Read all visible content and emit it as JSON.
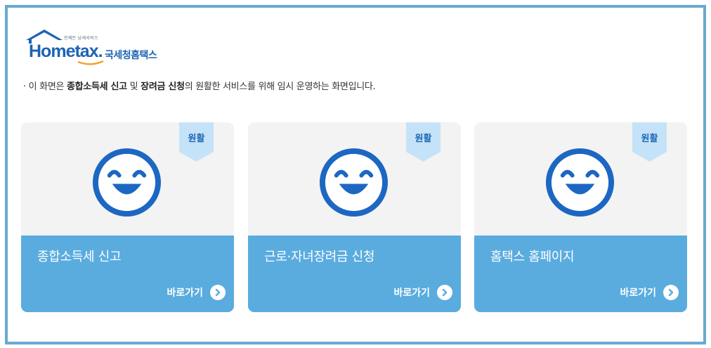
{
  "logo": {
    "tagline": "언제든 납세서비스",
    "word_hom": "Hom",
    "word_e": "e",
    "word_tax": "tax.",
    "korean_name": "국세청홈택스"
  },
  "notice": {
    "prefix": "· 이 화면은 ",
    "bold1": "종합소득세 신고",
    "middle": " 및 ",
    "bold2": "장려금 신청",
    "suffix": "의 원활한 서비스를 위해 임시 운영하는 화면입니다."
  },
  "colors": {
    "frame_border": "#6aaad0",
    "card_bottom": "#5aacdf",
    "card_top": "#f3f3f3",
    "ribbon": "#c5e3f8",
    "face": "#1c67c2",
    "logo_blue": "#1d63b3"
  },
  "cards": [
    {
      "status": "원활",
      "icon": "smiley-face-icon",
      "title": "종합소득세 신고",
      "link_label": "바로가기",
      "link_icon": "chevron-right-circle-icon"
    },
    {
      "status": "원활",
      "icon": "smiley-face-icon",
      "title": "근로·자녀장려금 신청",
      "link_label": "바로가기",
      "link_icon": "chevron-right-circle-icon"
    },
    {
      "status": "원활",
      "icon": "smiley-face-icon",
      "title": "홈택스 홈페이지",
      "link_label": "바로가기",
      "link_icon": "chevron-right-circle-icon"
    }
  ]
}
